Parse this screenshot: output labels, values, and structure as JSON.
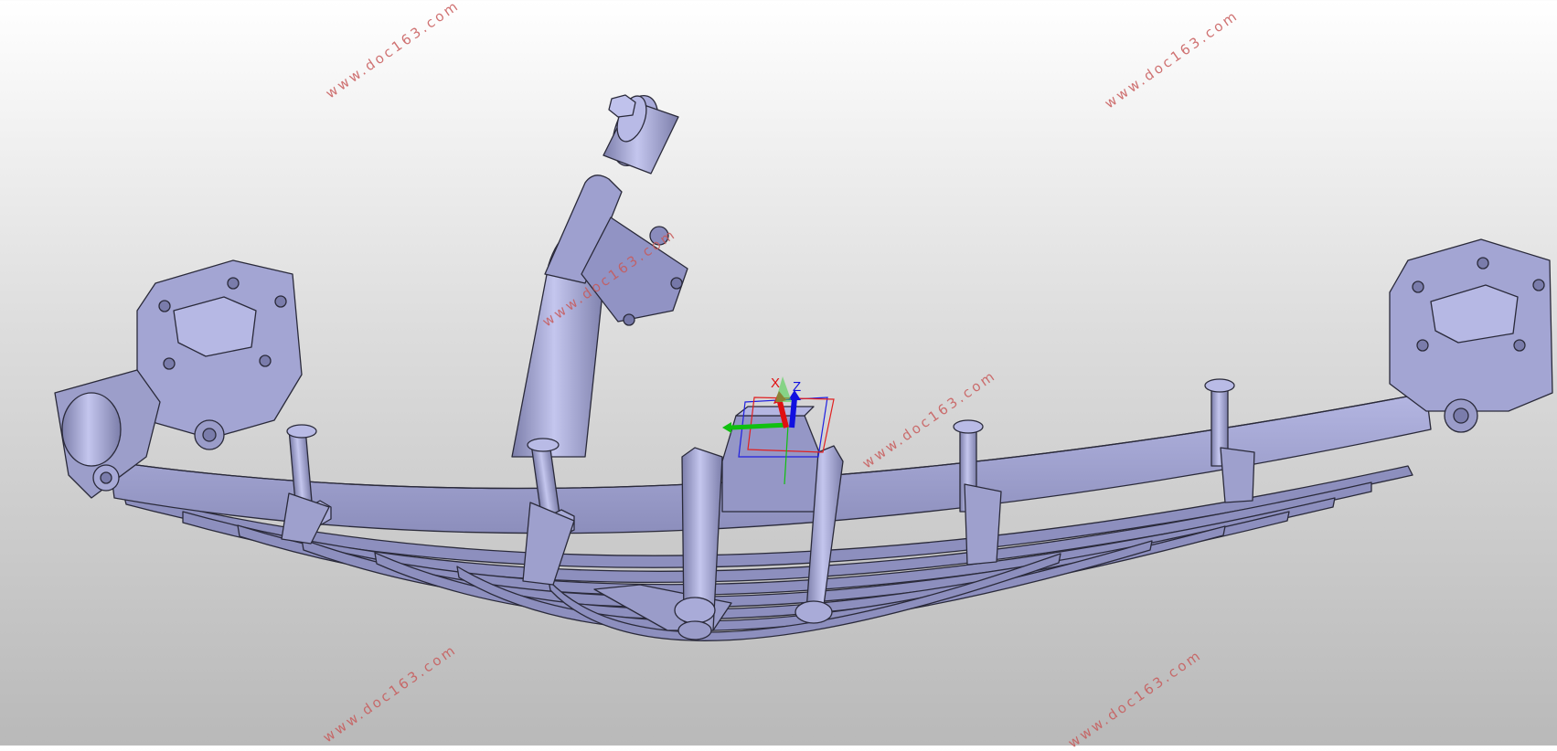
{
  "viewport": {
    "background_top": "#ffffff",
    "background_bottom": "#b9b9b9",
    "model_color": "#a8aad6",
    "edge_color": "#2a2a3a"
  },
  "triad": {
    "x_label": "X",
    "z_label": "Z",
    "x_color": "#e01010",
    "y_color": "#10c010",
    "z_color": "#1010e0"
  },
  "watermark": {
    "text": "www.doc163.com"
  }
}
